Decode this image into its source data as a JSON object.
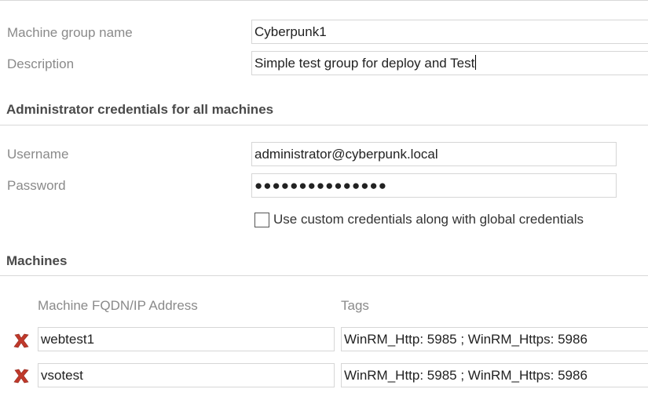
{
  "group": {
    "name_label": "Machine group name",
    "name_value": "Cyberpunk1",
    "description_label": "Description",
    "description_value": "Simple test group for deploy and Test"
  },
  "credentials": {
    "heading": "Administrator credentials for all machines",
    "username_label": "Username",
    "username_value": "administrator@cyberpunk.local",
    "password_label": "Password",
    "password_value": "●●●●●●●●●●●●●●●",
    "custom_checkbox_label": "Use custom credentials along with global credentials",
    "custom_checkbox_checked": false
  },
  "machines": {
    "heading": "Machines",
    "col_fqdn": "Machine FQDN/IP Address",
    "col_tags": "Tags",
    "rows": [
      {
        "fqdn": "webtest1",
        "tags": "WinRM_Http: 5985 ; WinRM_Https: 5986"
      },
      {
        "fqdn": "vsotest",
        "tags": "WinRM_Http: 5985 ; WinRM_Https: 5986"
      }
    ]
  },
  "colors": {
    "delete_icon": "#c0392b",
    "label": "#8a8a8a",
    "border": "#d6d6d6"
  },
  "icons": {
    "delete": "red-x-icon"
  }
}
